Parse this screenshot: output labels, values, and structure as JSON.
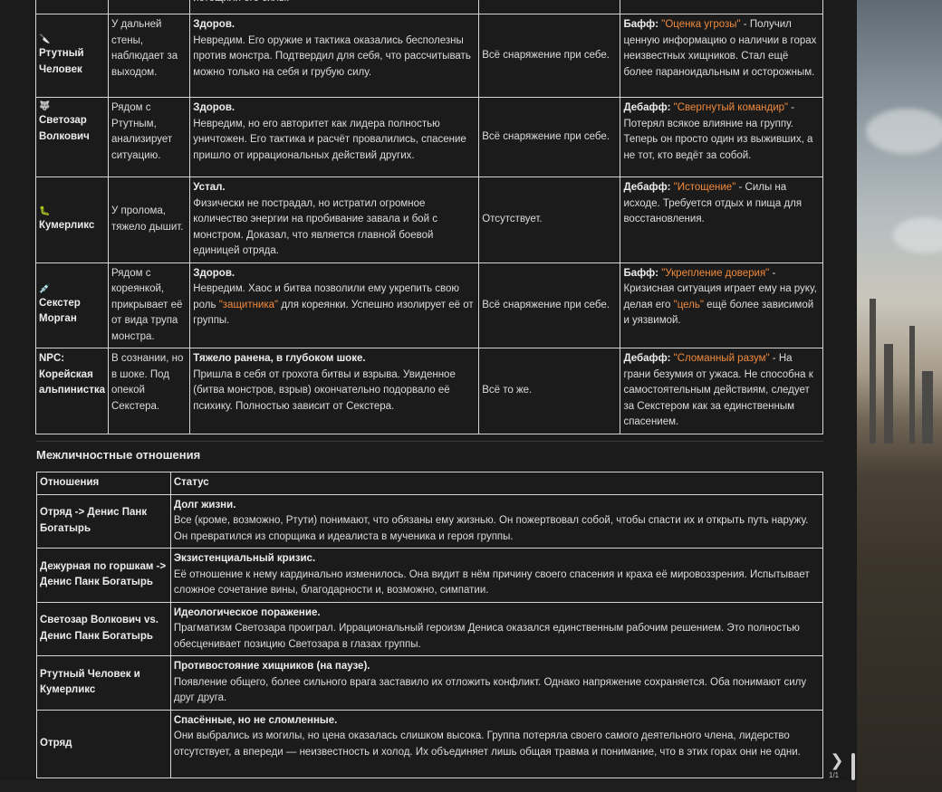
{
  "characters_table": {
    "top_fragment": "истощили его силы.",
    "rows": [
      {
        "icon": "🔪",
        "name": "Ртутный Человек",
        "location": "У дальней стены, наблюдает за выходом.",
        "state_title": "Здоров.",
        "state_text": "Невредим. Его оружие и тактика оказались бесполезны против монстра. Подтвердил для себя, что рассчитывать можно только на себя и грубую силу.",
        "equipment": "Всё снаряжение при себе.",
        "effect_type": "Бафф:",
        "effect_name": "\"Оценка угрозы\"",
        "effect_text": " - Получил ценную информацию о наличии в горах неизвестных хищников. Стал ещё более параноидальным и осторожным."
      },
      {
        "icon": "🐺",
        "name": "Светозар Волкович",
        "location": "Рядом с Ртутным, анализирует ситуацию.",
        "state_title": "Здоров.",
        "state_text": "Невредим, но его авторитет как лидера полностью уничтожен. Его тактика и расчёт провалились, спасение пришло от иррациональных действий других.",
        "equipment": "Всё снаряжение при себе.",
        "effect_type": "Дебафф:",
        "effect_name": "\"Свергнутый командир\"",
        "effect_text": " - Потерял всякое влияние на группу. Теперь он просто один из выживших, а не тот, кто ведёт за собой."
      },
      {
        "icon": "🐛",
        "name": "Кумерликс",
        "location": "У пролома, тяжело дышит.",
        "state_title": "Устал.",
        "state_text": "Физически не пострадал, но истратил огромное количество энергии на пробивание завала и бой с монстром. Доказал, что является главной боевой единицей отряда.",
        "equipment": "Отсутствует.",
        "effect_type": "Дебафф:",
        "effect_name": "\"Истощение\"",
        "effect_text": " - Силы на исходе. Требуется отдых и пища для восстановления."
      },
      {
        "icon": "💉",
        "name": "Секстер Морган",
        "location": "Рядом с кореянкой, прикрывает её от вида трупа монстра.",
        "state_title": "Здоров.",
        "state_text_pre": "Невредим. Хаос и битва позволили ему укрепить свою роль ",
        "state_text_hl": "\"защитника\"",
        "state_text_post": " для кореянки. Успешно изолирует её от группы.",
        "equipment": "Всё снаряжение при себе.",
        "effect_type": "Бафф:",
        "effect_name": "\"Укрепление доверия\"",
        "effect_text_pre": " - Кризисная ситуация играет ему на руку, делая его ",
        "effect_text_hl": "\"цель\"",
        "effect_text_post": " ещё более зависимой и уязвимой."
      },
      {
        "name": "NPC: Корейская альпинистка",
        "location": "В сознании, но в шоке. Под опекой Секстера.",
        "state_title": "Тяжело ранена, в глубоком шоке.",
        "state_text": "Пришла в себя от грохота битвы и взрыва. Увиденное (битва монстров, взрыв) окончательно подорвало её психику. Полностью зависит от Секстера.",
        "equipment": "Всё то же.",
        "effect_type": "Дебафф:",
        "effect_name": "\"Сломанный разум\"",
        "effect_text": " - На грани безумия от ужаса. Не способна к самостоятельным действиям, следует за Секстером как за единственным спасением."
      }
    ]
  },
  "relations": {
    "section_title": "Межличностные отношения",
    "col_relation": "Отношения",
    "col_status": "Статус",
    "rows": [
      {
        "relation": "Отряд -> Денис Панк Богатырь",
        "status_title": "Долг жизни.",
        "status_text": "Все (кроме, возможно, Ртути) понимают, что обязаны ему жизнью. Он пожертвовал собой, чтобы спасти их и открыть путь наружу. Он превратился из спорщика и идеалиста в мученика и героя группы."
      },
      {
        "relation": "Дежурная по горшкам -> Денис Панк Богатырь",
        "status_title": "Экзистенциальный кризис.",
        "status_text": "Её отношение к нему кардинально изменилось. Она видит в нём причину своего спасения и краха её мировоззрения. Испытывает сложное сочетание вины, благодарности и, возможно, симпатии."
      },
      {
        "relation": "Светозар Волкович vs. Денис Панк Богатырь",
        "status_title": "Идеологическое поражение.",
        "status_text": "Прагматизм Светозара проиграл. Иррациональный героизм Дениса оказался единственным рабочим решением. Это полностью обесценивает позицию Светозара в глазах группы."
      },
      {
        "relation": "Ртутный Человек и Кумерликс",
        "status_title": "Противостояние хищников (на паузе).",
        "status_text": "Появление общего, более сильного врага заставило их отложить конфликт. Однако напряжение сохраняется. Оба понимают силу друг друга."
      },
      {
        "relation": "Отряд",
        "status_title": "Спасённые, но не сломленные.",
        "status_text": "Они выбрались из могилы, но цена оказалась слишком высока. Группа потеряла своего самого деятельного члена, лидерство отсутствует, а впереди — неизвестность и холод. Их объединяет лишь общая травма и понимание, что в этих горах они не одни."
      }
    ]
  },
  "pager": {
    "arrow": "❯",
    "label": "1/1"
  },
  "colors": {
    "highlight": "#f08a3c",
    "border": "#d6d6d6",
    "background": "#1b1b1b"
  }
}
